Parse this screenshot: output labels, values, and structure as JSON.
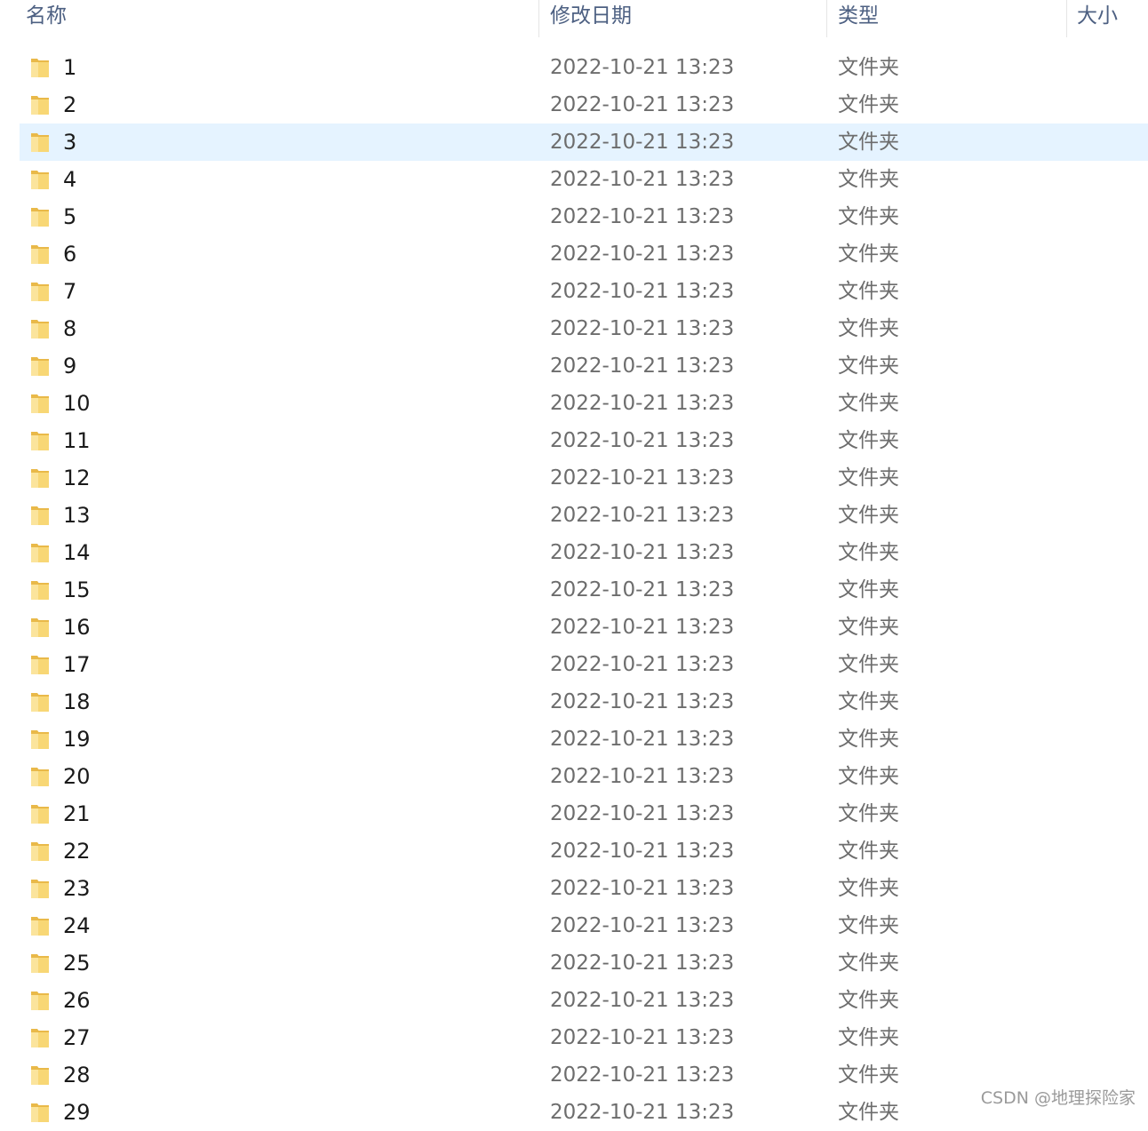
{
  "columns": {
    "name": "名称",
    "date": "修改日期",
    "type": "类型",
    "size": "大小"
  },
  "folder_icon": "folder-icon",
  "selected_index": 2,
  "colors": {
    "selection": "#e5f3ff",
    "header_text": "#4d6082",
    "folder_yellow": "#f8d775"
  },
  "rows": [
    {
      "name": "1",
      "date": "2022-10-21 13:23",
      "type": "文件夹"
    },
    {
      "name": "2",
      "date": "2022-10-21 13:23",
      "type": "文件夹"
    },
    {
      "name": "3",
      "date": "2022-10-21 13:23",
      "type": "文件夹"
    },
    {
      "name": "4",
      "date": "2022-10-21 13:23",
      "type": "文件夹"
    },
    {
      "name": "5",
      "date": "2022-10-21 13:23",
      "type": "文件夹"
    },
    {
      "name": "6",
      "date": "2022-10-21 13:23",
      "type": "文件夹"
    },
    {
      "name": "7",
      "date": "2022-10-21 13:23",
      "type": "文件夹"
    },
    {
      "name": "8",
      "date": "2022-10-21 13:23",
      "type": "文件夹"
    },
    {
      "name": "9",
      "date": "2022-10-21 13:23",
      "type": "文件夹"
    },
    {
      "name": "10",
      "date": "2022-10-21 13:23",
      "type": "文件夹"
    },
    {
      "name": "11",
      "date": "2022-10-21 13:23",
      "type": "文件夹"
    },
    {
      "name": "12",
      "date": "2022-10-21 13:23",
      "type": "文件夹"
    },
    {
      "name": "13",
      "date": "2022-10-21 13:23",
      "type": "文件夹"
    },
    {
      "name": "14",
      "date": "2022-10-21 13:23",
      "type": "文件夹"
    },
    {
      "name": "15",
      "date": "2022-10-21 13:23",
      "type": "文件夹"
    },
    {
      "name": "16",
      "date": "2022-10-21 13:23",
      "type": "文件夹"
    },
    {
      "name": "17",
      "date": "2022-10-21 13:23",
      "type": "文件夹"
    },
    {
      "name": "18",
      "date": "2022-10-21 13:23",
      "type": "文件夹"
    },
    {
      "name": "19",
      "date": "2022-10-21 13:23",
      "type": "文件夹"
    },
    {
      "name": "20",
      "date": "2022-10-21 13:23",
      "type": "文件夹"
    },
    {
      "name": "21",
      "date": "2022-10-21 13:23",
      "type": "文件夹"
    },
    {
      "name": "22",
      "date": "2022-10-21 13:23",
      "type": "文件夹"
    },
    {
      "name": "23",
      "date": "2022-10-21 13:23",
      "type": "文件夹"
    },
    {
      "name": "24",
      "date": "2022-10-21 13:23",
      "type": "文件夹"
    },
    {
      "name": "25",
      "date": "2022-10-21 13:23",
      "type": "文件夹"
    },
    {
      "name": "26",
      "date": "2022-10-21 13:23",
      "type": "文件夹"
    },
    {
      "name": "27",
      "date": "2022-10-21 13:23",
      "type": "文件夹"
    },
    {
      "name": "28",
      "date": "2022-10-21 13:23",
      "type": "文件夹"
    },
    {
      "name": "29",
      "date": "2022-10-21 13:23",
      "type": "文件夹"
    }
  ],
  "watermark": "CSDN @地理探险家"
}
